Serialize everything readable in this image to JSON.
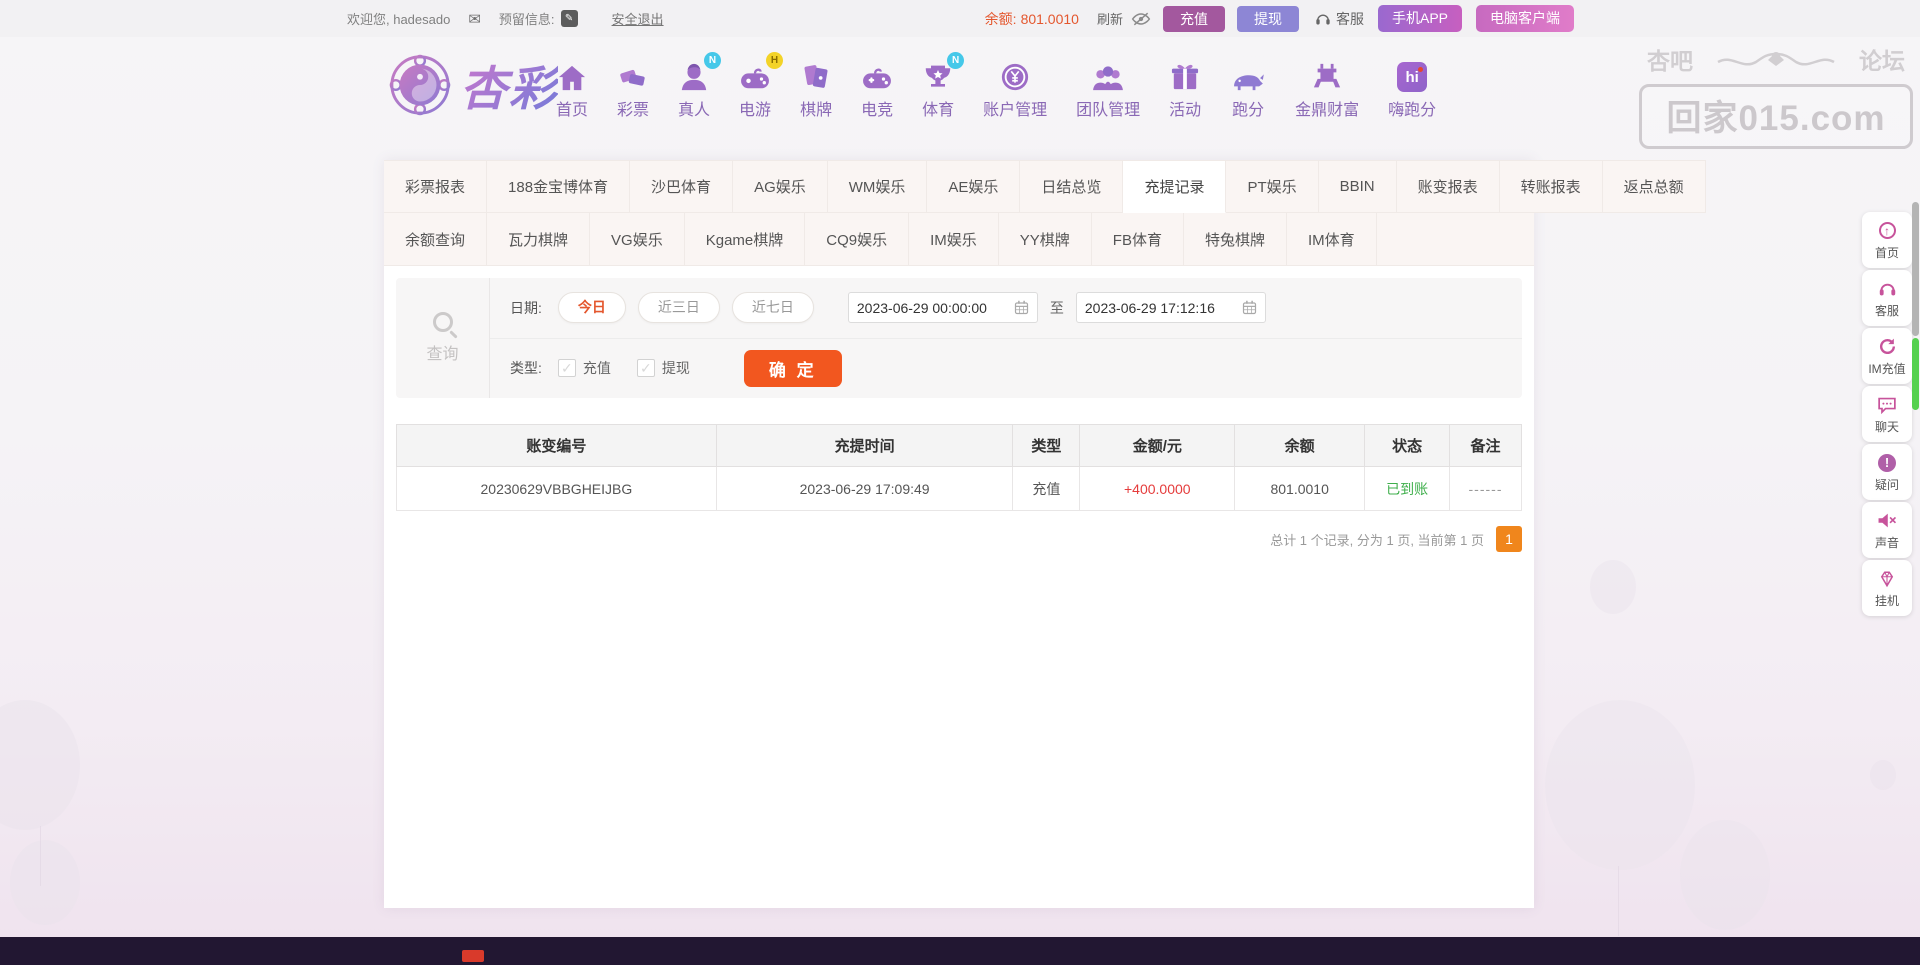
{
  "topbar": {
    "welcome": "欢迎您, hadesado",
    "reserved_info_label": "预留信息:",
    "logout_label": "安全退出",
    "balance_label": "余额:",
    "balance_value": "801.0010",
    "refresh_label": "刷新",
    "deposit_label": "充值",
    "withdraw_label": "提现",
    "service_label": "客服",
    "mobile_app_label": "手机APP",
    "pc_client_label": "电脑客户端"
  },
  "header": {
    "logo_text": "杏彩",
    "nav": [
      {
        "label": "首页",
        "icon": "home-icon",
        "badge": ""
      },
      {
        "label": "彩票",
        "icon": "lottery-ticket-icon",
        "badge": ""
      },
      {
        "label": "真人",
        "icon": "live-dealer-icon",
        "badge": "N"
      },
      {
        "label": "电游",
        "icon": "slots-gamepad-icon",
        "badge": "H"
      },
      {
        "label": "棋牌",
        "icon": "cards-icon",
        "badge": ""
      },
      {
        "label": "电竞",
        "icon": "esports-gamepad-icon",
        "badge": ""
      },
      {
        "label": "体育",
        "icon": "trophy-icon",
        "badge": "N"
      },
      {
        "label": "账户管理",
        "icon": "coin-icon",
        "badge": ""
      },
      {
        "label": "团队管理",
        "icon": "team-icon",
        "badge": ""
      },
      {
        "label": "活动",
        "icon": "gift-icon",
        "badge": ""
      },
      {
        "label": "跑分",
        "icon": "rhino-icon",
        "badge": ""
      },
      {
        "label": "金鼎财富",
        "icon": "ding-icon",
        "badge": ""
      },
      {
        "label": "嗨跑分",
        "icon": "hi-app-icon",
        "badge": ""
      }
    ]
  },
  "watermark": {
    "title_left": "杏吧",
    "title_right": "论坛",
    "site": "回家015.com"
  },
  "tabs": {
    "active": "充提记录",
    "row1": [
      "彩票报表",
      "188金宝博体育",
      "沙巴体育",
      "AG娱乐",
      "WM娱乐",
      "AE娱乐",
      "日结总览",
      "充提记录",
      "PT娱乐",
      "BBIN",
      "账变报表",
      "转账报表",
      "返点总额"
    ],
    "row2": [
      "余额查询",
      "瓦力棋牌",
      "VG娱乐",
      "Kgame棋牌",
      "CQ9娱乐",
      "IM娱乐",
      "YY棋牌",
      "FB体育",
      "特兔棋牌",
      "IM体育"
    ]
  },
  "filter": {
    "search_label": "查询",
    "date_label": "日期:",
    "date_presets": [
      "今日",
      "近三日",
      "近七日"
    ],
    "active_preset": "今日",
    "date_from": "2023-06-29 00:00:00",
    "to_label": "至",
    "date_to": "2023-06-29 17:12:16",
    "type_label": "类型:",
    "type_options": [
      "充值",
      "提现"
    ],
    "submit_label": "确 定"
  },
  "table": {
    "columns": [
      "账变编号",
      "充提时间",
      "类型",
      "金额/元",
      "余额",
      "状态",
      "备注"
    ],
    "rows": [
      {
        "record_no": "20230629VBBGHEIJBG",
        "time": "2023-06-29 17:09:49",
        "type": "充值",
        "amount": "+400.0000",
        "balance": "801.0010",
        "status": "已到账",
        "remark": "------"
      }
    ]
  },
  "pagination": {
    "summary": "总计 1 个记录, 分为 1 页, 当前第 1 页",
    "current_page": "1"
  },
  "sidebar": {
    "items": [
      {
        "label": "首页",
        "icon": "back-to-top-icon"
      },
      {
        "label": "客服",
        "icon": "headset-icon"
      },
      {
        "label": "IM充值",
        "icon": "im-recharge-icon"
      },
      {
        "label": "聊天",
        "icon": "chat-bubble-icon"
      },
      {
        "label": "疑问",
        "icon": "question-alert-icon"
      },
      {
        "label": "声音",
        "icon": "sound-muted-icon"
      },
      {
        "label": "挂机",
        "icon": "gem-icon"
      }
    ]
  },
  "colors": {
    "accent_orange": "#e4572e",
    "button_orange": "#f2571f",
    "page_orange": "#f0861c",
    "deposit_purple": "#a3589e",
    "withdraw_purple": "#8d86d5",
    "active_tab_purple": "#55457f",
    "nav_purple": "#8a68b5",
    "sidebar_pink": "#c7539b",
    "amount_red": "#e53c3c",
    "status_green": "#3faf4c",
    "footer_dark": "#221732"
  }
}
